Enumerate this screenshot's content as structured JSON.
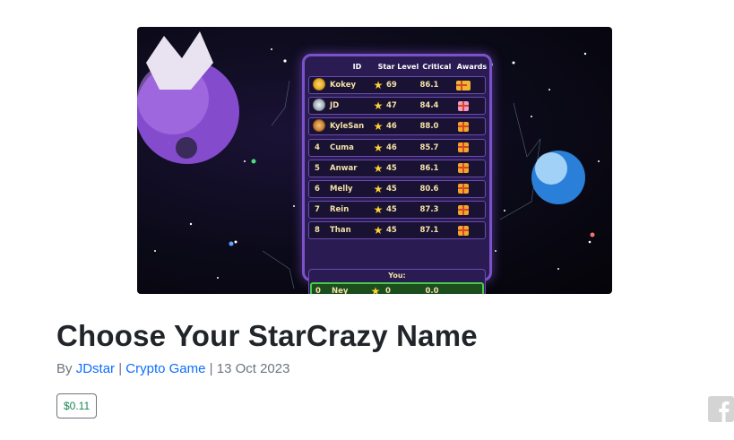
{
  "article": {
    "title": "Choose Your StarCrazy Name",
    "by_label": "By",
    "author": "JDstar",
    "separator": "|",
    "category": "Crypto Game",
    "date": "13 Oct 2023",
    "price": "$0.11"
  },
  "leaderboard": {
    "headers": {
      "id": "ID",
      "star_level": "Star Level",
      "critical": "Critical",
      "awards": "Awards"
    },
    "rows": [
      {
        "rank": "",
        "badge": "gold",
        "name": "Kokey",
        "level": "69",
        "critical": "86.1",
        "award": "chest"
      },
      {
        "rank": "",
        "badge": "silver",
        "name": "JD",
        "level": "47",
        "critical": "84.4",
        "award": "pink"
      },
      {
        "rank": "",
        "badge": "bronze",
        "name": "KyleSan",
        "level": "46",
        "critical": "88.0",
        "award": "gift"
      },
      {
        "rank": "4",
        "badge": "",
        "name": "Cuma",
        "level": "46",
        "critical": "85.7",
        "award": "gift"
      },
      {
        "rank": "5",
        "badge": "",
        "name": "Anwar",
        "level": "45",
        "critical": "86.1",
        "award": "gift"
      },
      {
        "rank": "6",
        "badge": "",
        "name": "Melly",
        "level": "45",
        "critical": "80.6",
        "award": "gift"
      },
      {
        "rank": "7",
        "badge": "",
        "name": "Rein",
        "level": "45",
        "critical": "87.3",
        "award": "gift"
      },
      {
        "rank": "8",
        "badge": "",
        "name": "Than",
        "level": "45",
        "critical": "87.1",
        "award": "gift"
      }
    ],
    "you_label": "You:",
    "you": {
      "rank": "0",
      "name": "Ney",
      "level": "0",
      "critical": "0.0"
    }
  },
  "icons": {
    "share": "facebook-icon",
    "star": "star-icon"
  },
  "colors": {
    "link": "#0d6efd",
    "price": "#198754",
    "you_row": "#49c94b",
    "board_border": "#7b52c9"
  }
}
